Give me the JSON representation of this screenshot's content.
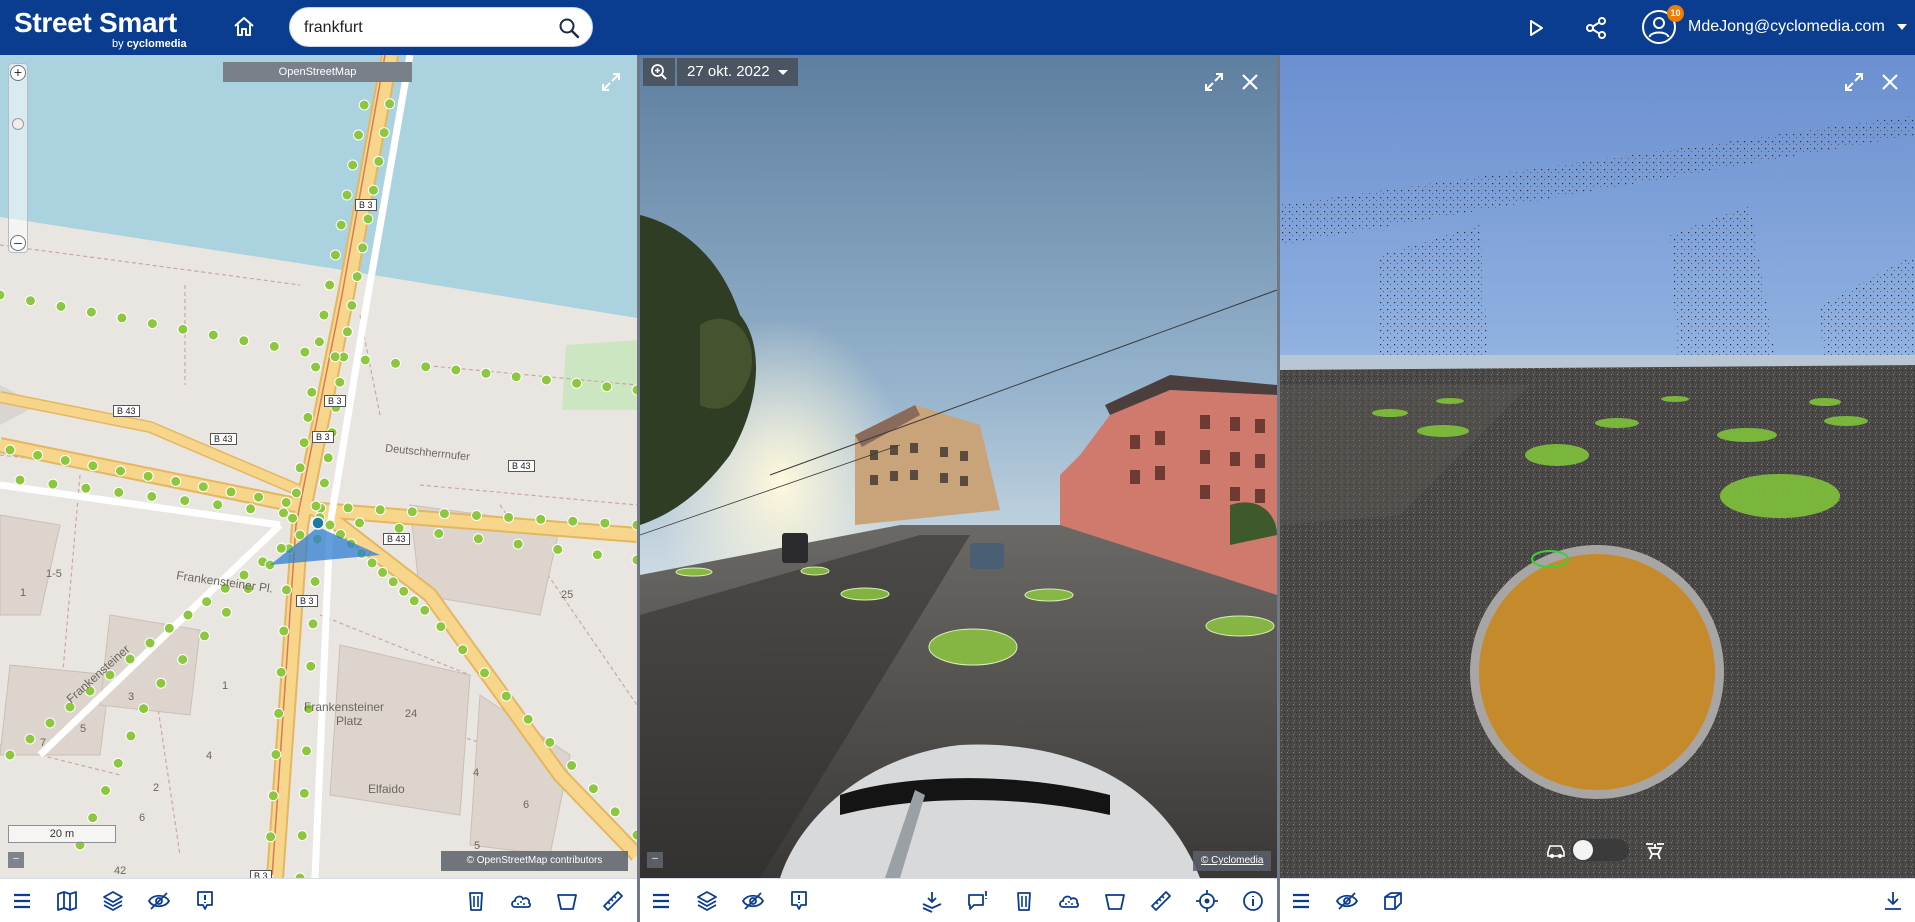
{
  "header": {
    "app_title": "Street Smart",
    "app_subtitle_prefix": "by",
    "app_subtitle_brand": "cyclomedia",
    "search": {
      "value": "frankfurt",
      "placeholder": ""
    },
    "user": {
      "email": "MdeJong@cyclomedia.com",
      "badge_count": "10"
    },
    "icons": [
      "home-icon",
      "search-icon",
      "play-icon",
      "share-icon",
      "user-icon",
      "chevron-down-icon"
    ]
  },
  "map_panel": {
    "source_label": "OpenStreetMap",
    "scale_label": "20 m",
    "attribution": "© OpenStreetMap contributors",
    "minimize_label": "–",
    "zoom_in": "+",
    "zoom_out": "–",
    "street_labels": {
      "deutschherrnufer": "Deutschherrnufer",
      "frankensteiner_pl": "Frankensteiner Pl.",
      "frankensteiner_platz_1": "Frankensteiner",
      "frankensteiner_platz_2": "Platz",
      "elfaido": "Elfaido",
      "frankfurter_str": "Frankensteiner"
    },
    "road_shields": [
      "B 3",
      "B 3",
      "B 3",
      "B 43",
      "B 43",
      "B 43",
      "B 43",
      "B 3",
      "B 3"
    ],
    "house_numbers": [
      "1-5",
      "1",
      "25",
      "3",
      "1",
      "5",
      "24",
      "7",
      "4",
      "2",
      "6",
      "4",
      "6",
      "5",
      "42"
    ]
  },
  "photo_panel": {
    "date_label": "27 okt. 2022",
    "attribution": "© Cyclomedia",
    "minimize_label": "–"
  },
  "cloud_panel": {
    "toggle_state": "off"
  },
  "toolbars": {
    "map": [
      "menu-icon",
      "map-icon",
      "layers-icon",
      "visibility-off-icon",
      "report-icon",
      "trash-bin-icon",
      "point-cloud-icon",
      "area-measure-icon",
      "ruler-icon"
    ],
    "photo": [
      "menu-icon",
      "layers-icon",
      "visibility-off-icon",
      "report-icon",
      "overlay-measure-icon",
      "comment-icon",
      "trash-bin-icon",
      "point-cloud-icon",
      "area-measure-icon",
      "ruler-icon",
      "locate-icon",
      "info-icon"
    ],
    "cloud": [
      "menu-icon",
      "visibility-off-icon",
      "cube-icon",
      "download-icon"
    ]
  },
  "colors": {
    "header_bg": "#0a3d8f",
    "water": "#aad3df",
    "main_road": "#f7d68b",
    "recording_dot": "#8dc63f",
    "view_cone": "#2f7dd3",
    "badge": "#f07d00",
    "cursor_disc": "#c9871f"
  }
}
